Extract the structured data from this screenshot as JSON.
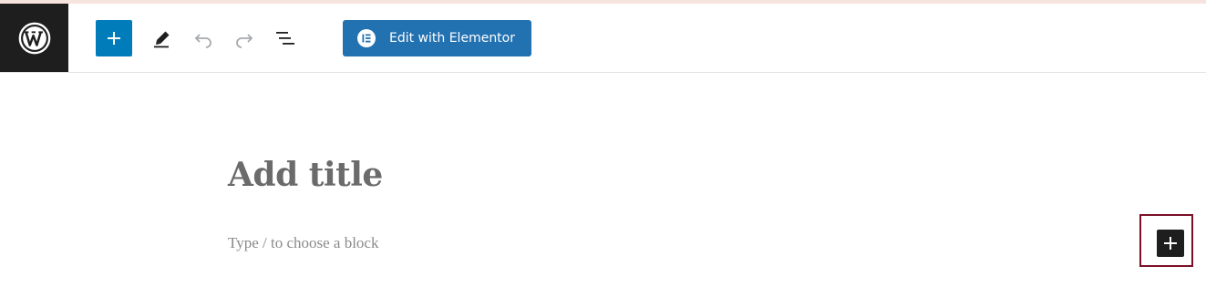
{
  "header": {
    "logo_icon": "wordpress-logo-icon",
    "inserter_icon": "plus-icon",
    "tools_icon": "pencil-icon",
    "undo_icon": "undo-icon",
    "redo_icon": "redo-icon",
    "outline_icon": "list-view-icon",
    "elementor_button_label": "Edit with Elementor",
    "elementor_icon": "elementor-icon"
  },
  "editor": {
    "title_placeholder": "Add title",
    "block_placeholder": "Type / to choose a block",
    "add_block_icon": "plus-icon"
  },
  "colors": {
    "accent": "#007cba",
    "elementor": "#2271b1",
    "dark": "#1e1e1e",
    "highlight": "#7a1028"
  }
}
